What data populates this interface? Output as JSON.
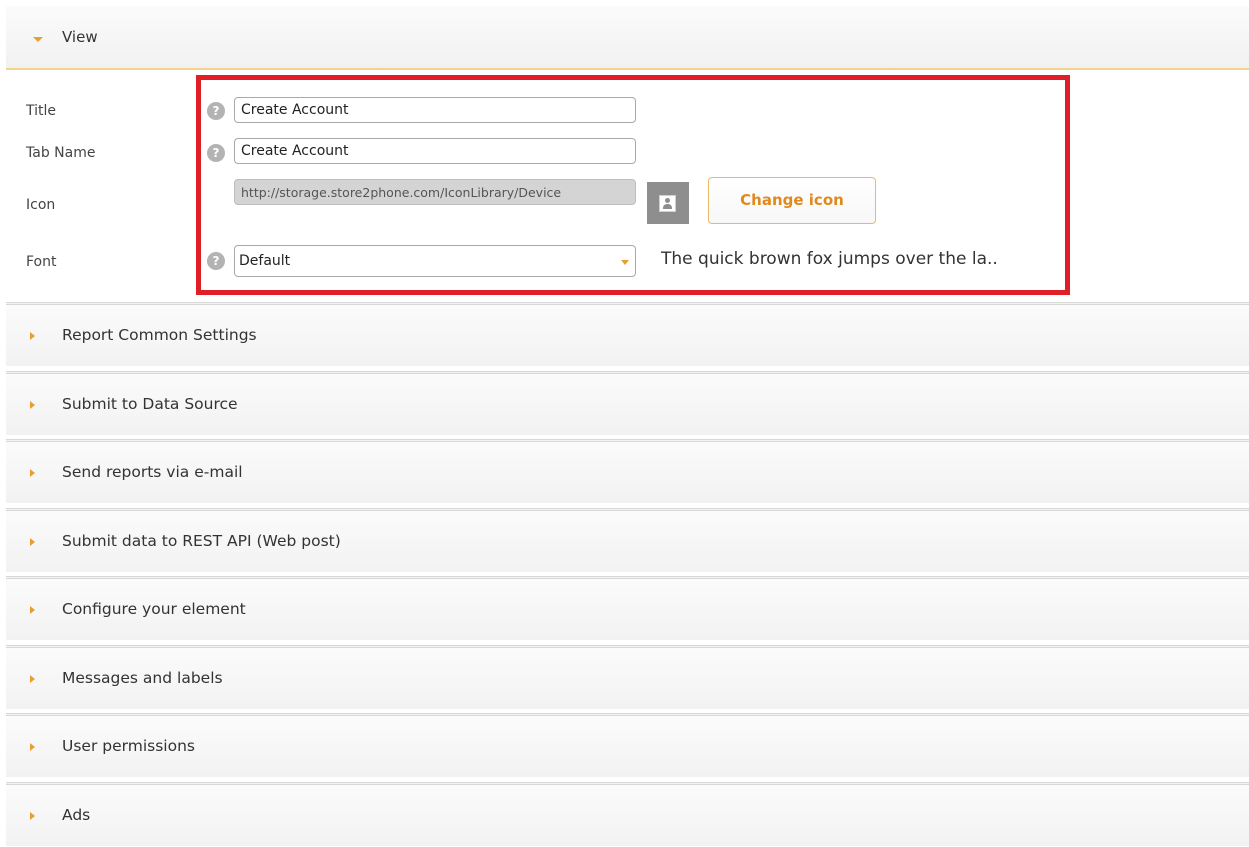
{
  "view": {
    "header_label": "View",
    "fields": {
      "title": {
        "label": "Title",
        "value": "Create Account",
        "help": "?"
      },
      "tab_name": {
        "label": "Tab Name",
        "value": "Create Account",
        "help": "?"
      },
      "icon": {
        "label": "Icon",
        "url": "http://storage.store2phone.com/IconLibrary/Device",
        "button_label": "Change icon",
        "thumb_icon": "user-placeholder-icon"
      },
      "font": {
        "label": "Font",
        "selected": "Default",
        "help": "?",
        "preview": "The quick brown fox jumps over the la.."
      }
    }
  },
  "sections": [
    {
      "label": "Report Common Settings"
    },
    {
      "label": "Submit to Data Source"
    },
    {
      "label": "Send reports via e-mail"
    },
    {
      "label": "Submit data to REST API (Web post)"
    },
    {
      "label": "Configure your element"
    },
    {
      "label": "Messages and labels"
    },
    {
      "label": "User permissions"
    },
    {
      "label": "Ads"
    }
  ],
  "colors": {
    "accent": "#e7a02f",
    "highlight_border": "#e01e27",
    "button_text": "#e08a1e"
  }
}
